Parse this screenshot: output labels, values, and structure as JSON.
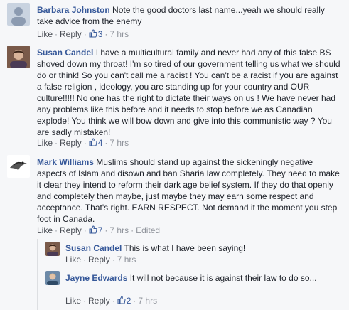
{
  "comments": [
    {
      "author": "Barbara Johnston",
      "text": "Note the good doctors last name...yeah we should really take advice from the enemy",
      "like": "Like",
      "reply": "Reply",
      "likes": "3",
      "time": "7 hrs"
    },
    {
      "author": "Susan Candel",
      "text": "I have a multicultural family and never had any of this false BS shoved down my throat! I'm so tired of our government telling us what we should do or think! So you can't call me a racist ! You can't be a racist if you are against a false religion , ideology, you are standing up for your country and OUR culture!!!!! No one has the right to dictate their ways on us ! We have never had any problems like this before and it needs to stop before we as Canadian explode! You think we will bow down and give into this communistic way ? You are sadly mistaken!",
      "like": "Like",
      "reply": "Reply",
      "likes": "4",
      "time": "7 hrs"
    },
    {
      "author": "Mark Williams",
      "text": "Muslims should stand up against the sickeningly negative aspects of Islam and disown and ban Sharia law completely. They need to make it clear they intend to reform their dark age belief system. If they do that openly and completely then maybe, just maybe they may earn some respect and acceptance. That's right. EARN RESPECT. Not demand it the moment you step foot in Canada.",
      "like": "Like",
      "reply": "Reply",
      "likes": "7",
      "time": "7 hrs",
      "edited": "Edited"
    }
  ],
  "replies": [
    {
      "author": "Susan Candel",
      "text": "This is what I have been saying!",
      "like": "Like",
      "reply": "Reply",
      "time": "7 hrs"
    },
    {
      "author": "Jayne Edwards",
      "text": "It will not because it is against their law to do so...",
      "like": "Like",
      "reply": "Reply",
      "likes": "2",
      "time": "7 hrs"
    }
  ]
}
